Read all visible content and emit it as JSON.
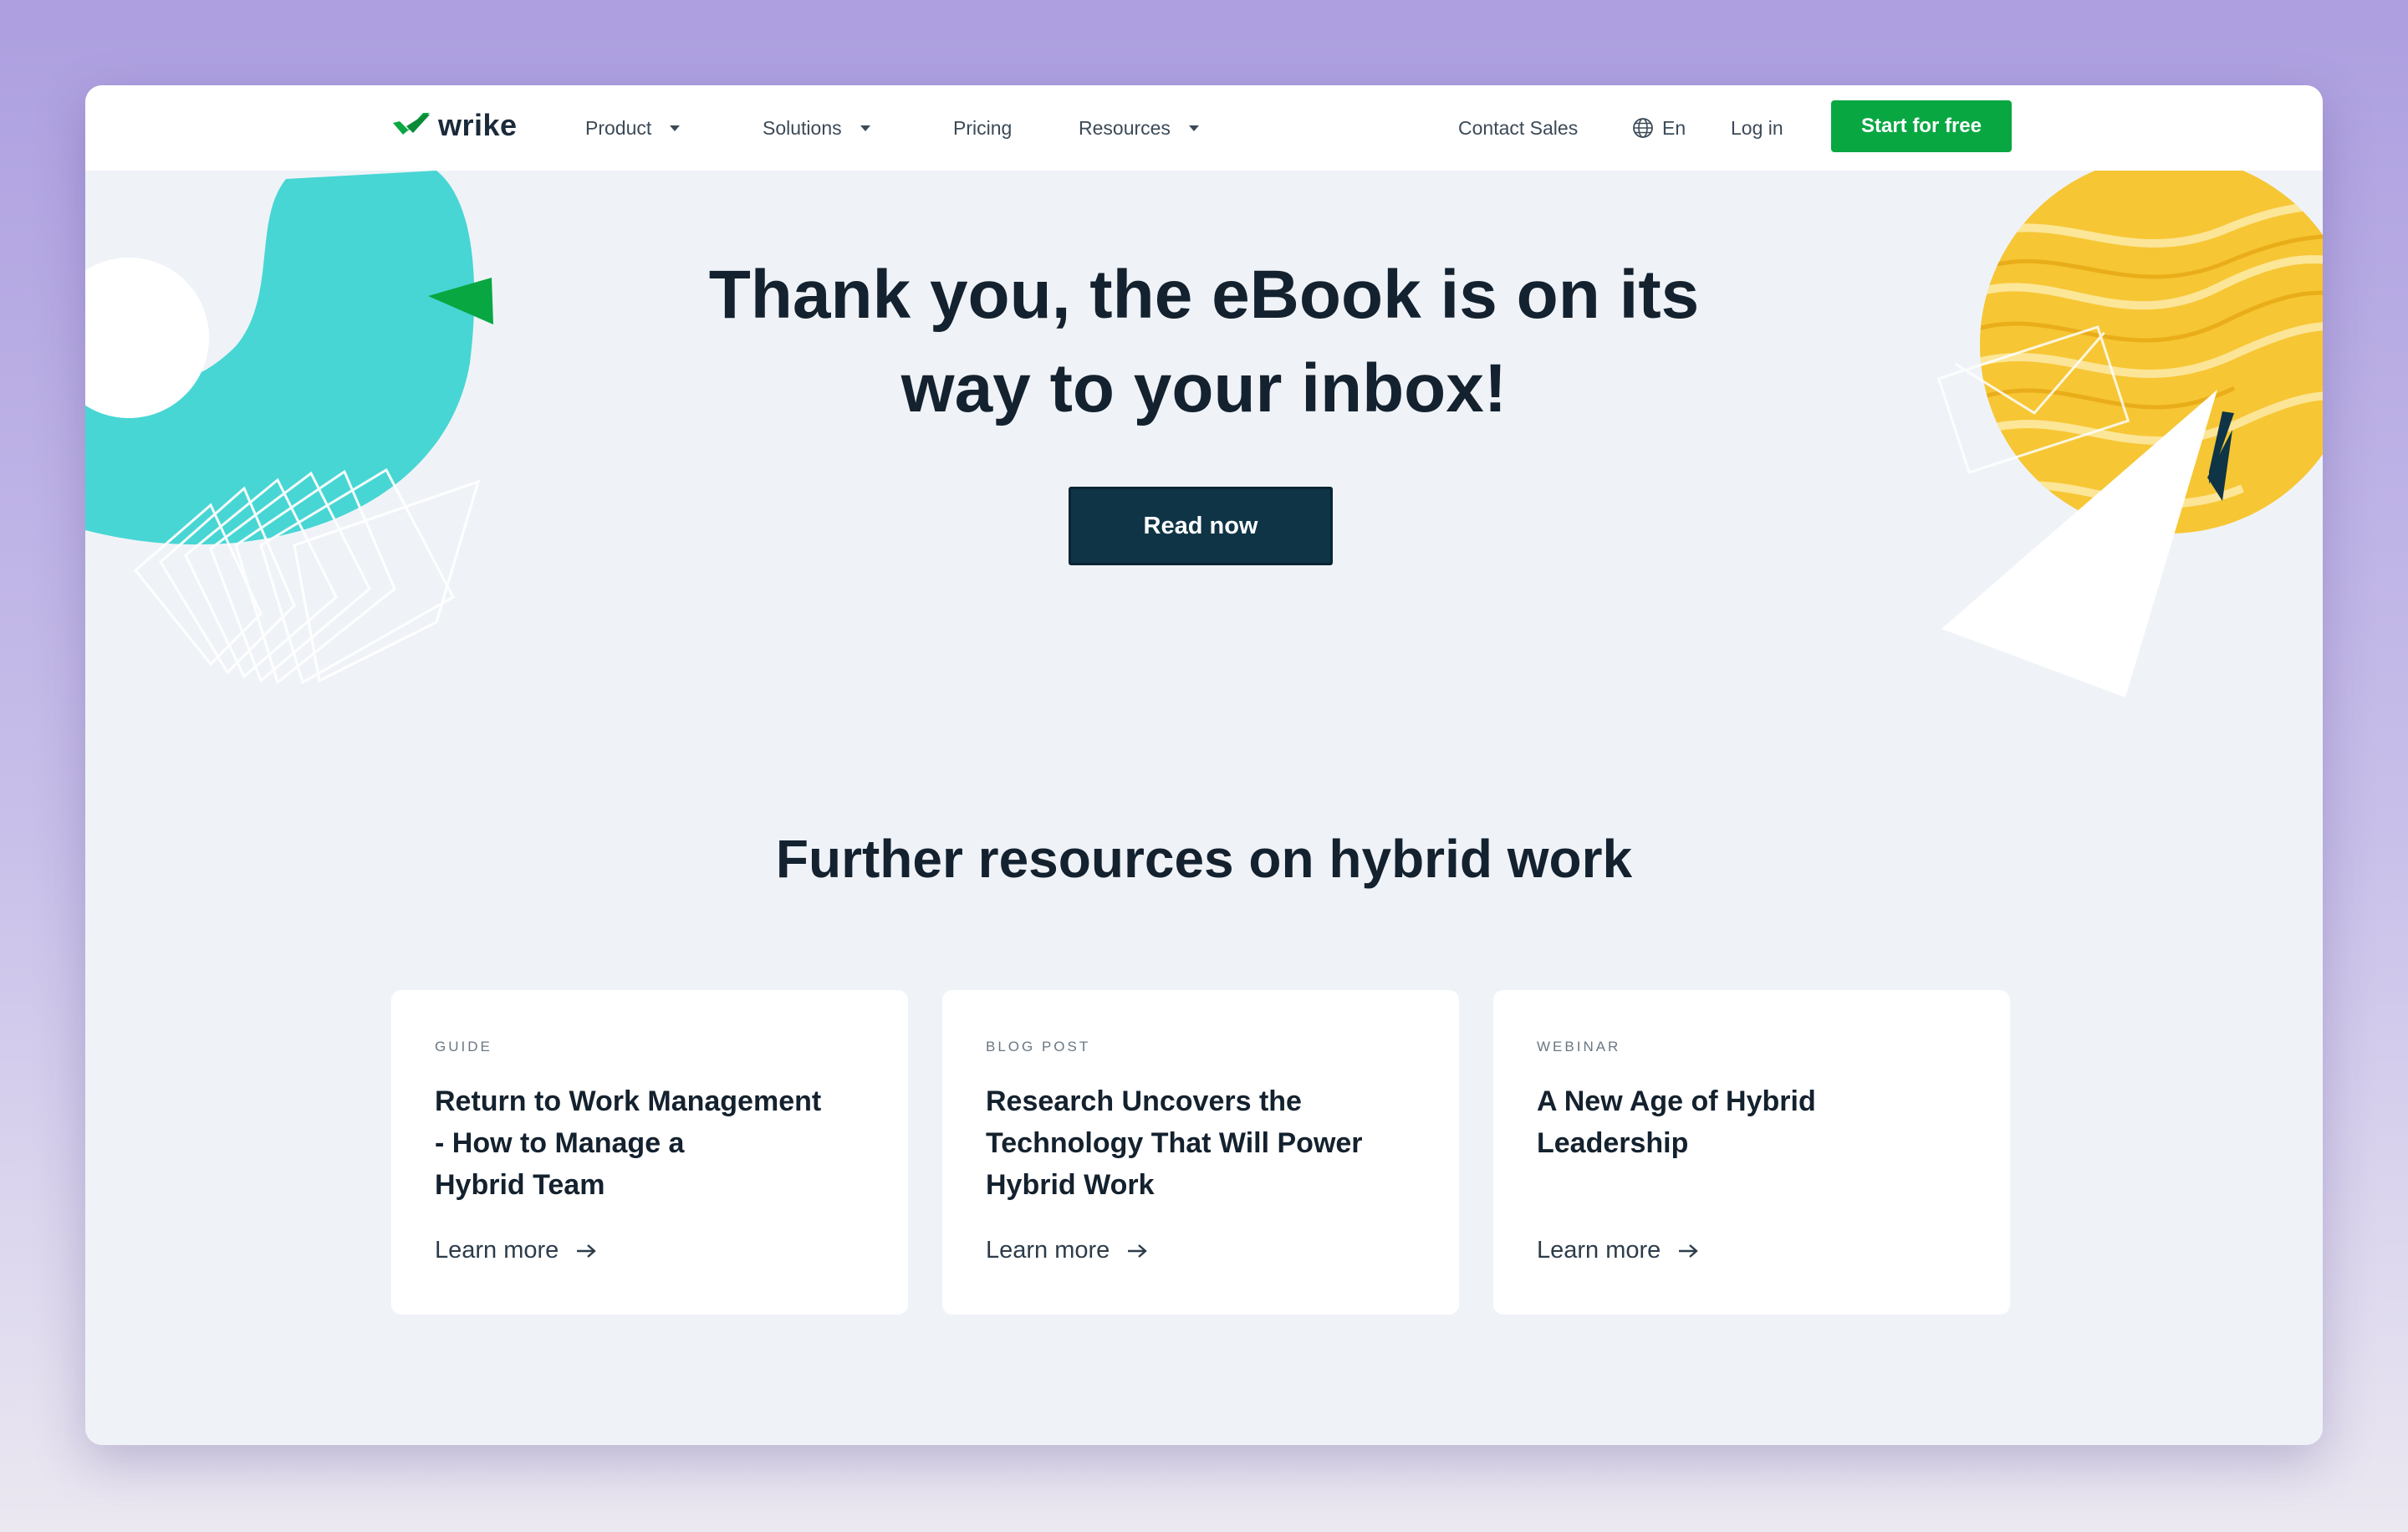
{
  "nav": {
    "logo_text": "wrike",
    "items": [
      {
        "label": "Product"
      },
      {
        "label": "Solutions"
      },
      {
        "label": "Pricing"
      },
      {
        "label": "Resources"
      }
    ],
    "contact_sales": "Contact Sales",
    "language": "En",
    "login": "Log in",
    "cta": "Start for free"
  },
  "hero": {
    "title_lines": [
      "Thank you, the eBook is on its",
      "way to your inbox!"
    ],
    "button": "Read now"
  },
  "resources": {
    "title": "Further resources on hybrid work",
    "cards": [
      {
        "type": "GUIDE",
        "title_lines": [
          "Return to Work Management",
          "- How to Manage a",
          "Hybrid Team"
        ],
        "link": "Learn more"
      },
      {
        "type": "BLOG POST",
        "title_lines": [
          "Research Uncovers the",
          "Technology That Will Power",
          "Hybrid Work"
        ],
        "link": "Learn more"
      },
      {
        "type": "WEBINAR",
        "title_lines": [
          "A New Age of Hybrid",
          "Leadership"
        ],
        "link": "Learn more"
      }
    ]
  },
  "colors": {
    "accent_green": "#08a742",
    "dark_button": "#0e3446",
    "teal_shape": "#47d6d4",
    "yellow_shape": "#f6c634"
  },
  "icons": {
    "logo": "checkmark-logo-icon",
    "dropdown": "caret-down-icon",
    "language": "globe-icon",
    "link": "arrow-right-icon"
  }
}
